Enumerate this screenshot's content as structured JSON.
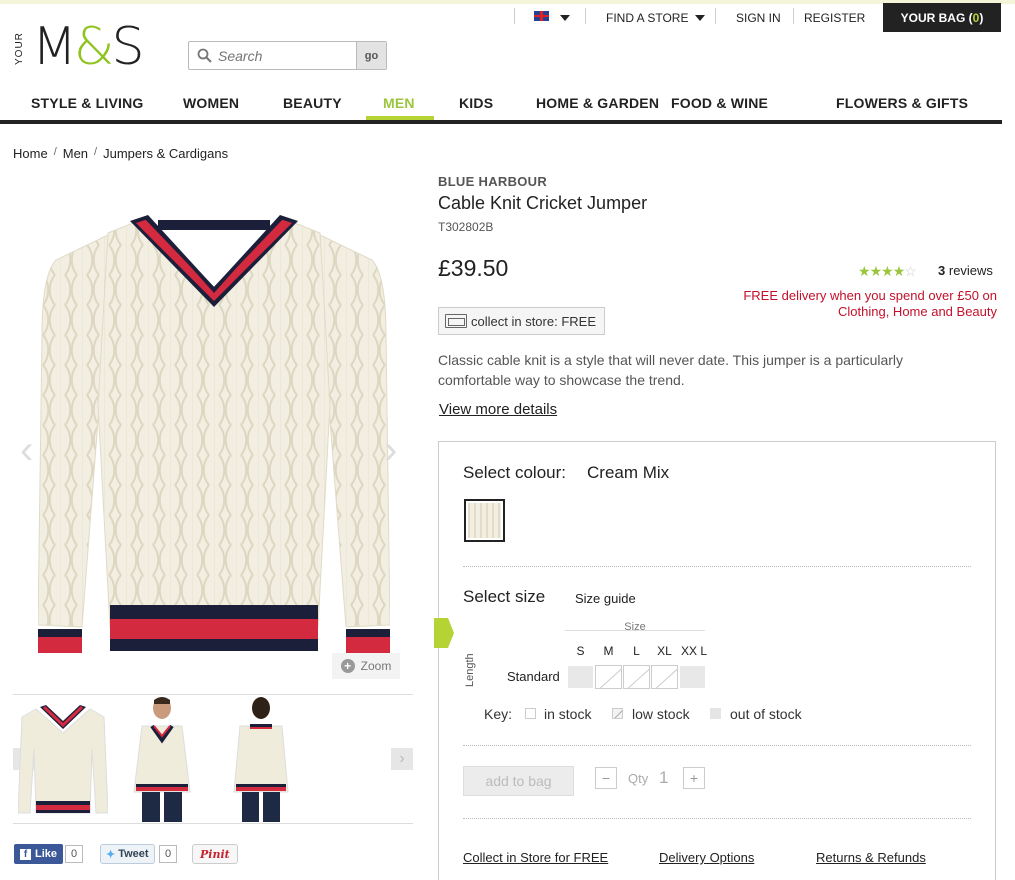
{
  "header": {
    "logo_prefix": "YOUR",
    "logo_m": "M",
    "logo_amp": "&",
    "logo_s": "S",
    "find_store": "FIND A STORE",
    "sign_in": "SIGN IN",
    "register": "REGISTER",
    "bag_label": "YOUR BAG",
    "bag_open": "(",
    "bag_count": "0",
    "bag_close": ")",
    "search_placeholder": "Search",
    "search_go": "go"
  },
  "nav": {
    "items": [
      "STYLE & LIVING",
      "WOMEN",
      "BEAUTY",
      "MEN",
      "KIDS",
      "HOME & GARDEN",
      "FOOD & WINE",
      "FLOWERS & GIFTS"
    ],
    "active": "MEN"
  },
  "breadcrumb": [
    "Home",
    "Men",
    "Jumpers & Cardigans"
  ],
  "breadcrumb_sep": "/",
  "product": {
    "brand": "BLUE HARBOUR",
    "title": "Cable Knit Cricket Jumper",
    "code": "T302802B",
    "price": "£39.50",
    "rating": 4,
    "rating_max": 5,
    "reviews_count": "3",
    "reviews_label": "reviews",
    "delivery_line1": "FREE delivery when you spend over £50 on",
    "delivery_line2": "Clothing, Home and Beauty",
    "collect_label": "collect in store: FREE",
    "description": "Classic cable knit is a style that will never date. This jumper is a particularly comfortable way to showcase the trend.",
    "view_more": "View more details",
    "zoom": "Zoom"
  },
  "colours": {
    "label": "Select colour:",
    "selected": "Cream Mix"
  },
  "sizes": {
    "label": "Select size",
    "guide": "Size guide",
    "caption": "Size",
    "length_label": "Length",
    "row_label": "Standard",
    "columns": [
      "S",
      "M",
      "L",
      "XL",
      "XX L"
    ],
    "stock": [
      "out",
      "low",
      "low",
      "low",
      "out"
    ],
    "key_label": "Key:",
    "key_in": "in stock",
    "key_low": "low stock",
    "key_out": "out of stock"
  },
  "purchase": {
    "add_to_bag": "add to bag",
    "minus": "−",
    "plus": "+",
    "qty_label": "Qty",
    "qty_value": "1"
  },
  "footer_links": {
    "collect": "Collect in Store for FREE",
    "delivery": "Delivery Options",
    "returns": "Returns & Refunds"
  },
  "social": {
    "like": "Like",
    "like_count": "0",
    "tweet": "Tweet",
    "tweet_count": "0",
    "pin": "Pinit"
  },
  "colors": {
    "accent_green": "#b5d334",
    "sale_red": "#c3112b",
    "bag_bg": "#222222"
  }
}
